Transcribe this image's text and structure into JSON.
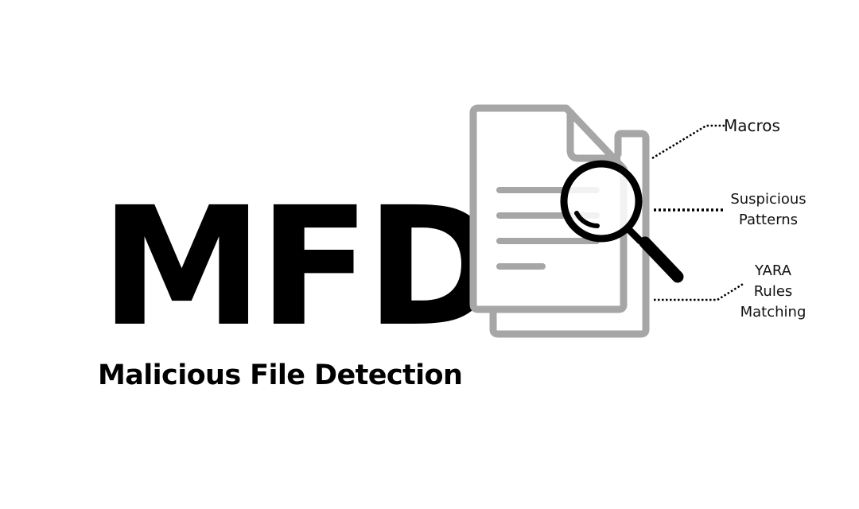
{
  "logo": {
    "acronym": "MFD",
    "subtitle": "Malicious File Detection"
  },
  "callouts": {
    "macros": {
      "line1": "Macros"
    },
    "patterns": {
      "line1": "Suspicious",
      "line2": "Patterns"
    },
    "yara": {
      "line1": "YARA",
      "line2": "Rules",
      "line3": "Matching"
    }
  },
  "colors": {
    "document": "#a6a6a6",
    "magnifier": "#000000",
    "text": "#000000",
    "background": "#ffffff"
  },
  "icons": {
    "documents": "stacked-documents-icon",
    "magnifier": "magnifying-glass-icon"
  }
}
